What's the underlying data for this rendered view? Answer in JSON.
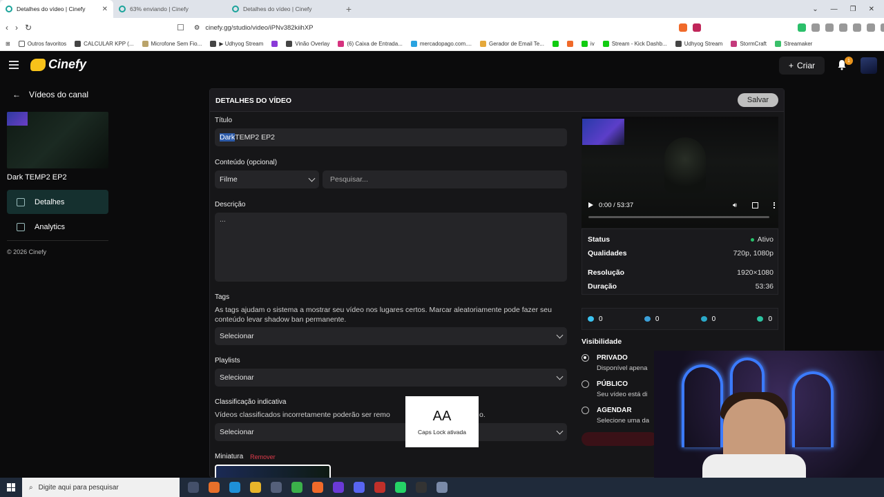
{
  "browser": {
    "tabs": [
      {
        "label": "Detalhes do vídeo | Cinefy",
        "active": true
      },
      {
        "label": "63% enviando | Cinefy",
        "active": false
      },
      {
        "label": "Detalhes do vídeo | Cinefy",
        "active": false
      }
    ],
    "url": "cinefy.gg/studio/video/iPNv382kiihXP",
    "bookmarks": [
      "Outros favoritos",
      "CALCULAR KPP (...",
      "Microfone Sem Fio...",
      "▶ Udhyog Stream",
      "Vinão Overlay",
      "(6) Caixa de Entrada...",
      "mercadopago.com....",
      "Gerador de Email Te...",
      "iv",
      "Stream - Kick Dashb...",
      "Udhyog Stream",
      "StormCraft",
      "Streamaker"
    ]
  },
  "app": {
    "logo": "Cinefy",
    "create_label": "Criar",
    "notification_count": "1"
  },
  "sidebar": {
    "back_label": "Vídeos do canal",
    "video_title": "Dark TEMP2 EP2",
    "items": [
      {
        "label": "Detalhes",
        "active": true
      },
      {
        "label": "Analytics",
        "active": false
      }
    ],
    "copyright": "© 2026 Cinefy"
  },
  "panel": {
    "header": "DETALHES DO VÍDEO",
    "save_label": "Salvar",
    "title_label": "Título",
    "title_selected": "Dark",
    "title_rest": " TEMP2 EP2",
    "content_label": "Conteúdo (opcional)",
    "content_type": "Filme",
    "content_search_placeholder": "Pesquisar...",
    "description_label": "Descrição",
    "description_value": "...",
    "tags_label": "Tags",
    "tags_help": "As tags ajudam o sistema a mostrar seu vídeo nos lugares certos. Marcar aleatoriamente pode fazer seu conteúdo levar shadow ban permanente.",
    "tags_placeholder": "Selecionar",
    "playlists_label": "Playlists",
    "playlists_placeholder": "Selecionar",
    "rating_label": "Classificação indicativa",
    "rating_help_left": "Vídeos classificados incorretamente poderão ser remo",
    "rating_help_right": "o.",
    "rating_placeholder": "Selecionar",
    "thumbnail_label": "Miniatura",
    "thumbnail_remove": "Remover"
  },
  "player": {
    "time": "0:00 / 53:37"
  },
  "info": {
    "status_k": "Status",
    "status_v": "Ativo",
    "qualities_k": "Qualidades",
    "qualities_v": "720p, 1080p",
    "resolution_k": "Resolução",
    "resolution_v": "1920×1080",
    "duration_k": "Duração",
    "duration_v": "53:36"
  },
  "stats": {
    "likes": "0",
    "views": "0",
    "third": "0",
    "comments": "0"
  },
  "visibility": {
    "title": "Visibilidade",
    "options": [
      {
        "label": "PRIVADO",
        "sub": "Disponível apena",
        "selected": true
      },
      {
        "label": "PÚBLICO",
        "sub": "Seu vídeo está di",
        "selected": false
      },
      {
        "label": "AGENDAR",
        "sub": "Selecione uma da",
        "selected": false
      }
    ]
  },
  "caps_lock": {
    "glyph": "AA",
    "text": "Caps Lock ativada"
  },
  "taskbar": {
    "search_placeholder": "Digite aqui para pesquisar"
  },
  "colors": {
    "accent": "#15302f",
    "danger": "#e03b4b",
    "status_ok": "#27c26b",
    "logo": "#f7c21a"
  }
}
